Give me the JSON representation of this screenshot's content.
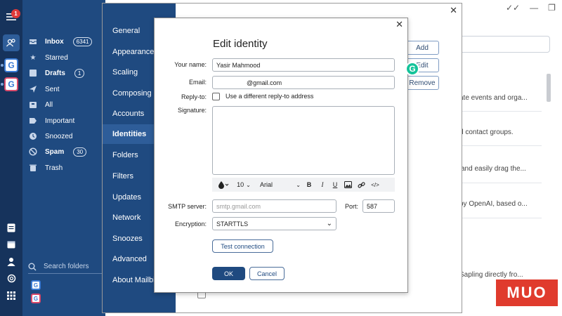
{
  "rail": {
    "notification_count": "1"
  },
  "folders": [
    {
      "label": "Inbox",
      "count": "6341",
      "bold": true
    },
    {
      "label": "Starred",
      "count": "",
      "bold": false
    },
    {
      "label": "Drafts",
      "count": "1",
      "bold": true
    },
    {
      "label": "Sent",
      "count": "",
      "bold": false
    },
    {
      "label": "All",
      "count": "",
      "bold": false
    },
    {
      "label": "Important",
      "count": "",
      "bold": false
    },
    {
      "label": "Snoozed",
      "count": "",
      "bold": false
    },
    {
      "label": "Spam",
      "count": "30",
      "bold": true
    },
    {
      "label": "Trash",
      "count": "",
      "bold": false
    }
  ],
  "search_folders": "Search folders",
  "background_rows": [
    "ate events and orga...",
    "d contact groups.",
    "and easily drag the...",
    "by OpenAI, based o...",
    "Sapling directly fro..."
  ],
  "settings": {
    "nav": [
      "General",
      "Appearance",
      "Scaling",
      "Composing",
      "Accounts",
      "Identities",
      "Folders",
      "Filters",
      "Updates",
      "Network",
      "Snoozes",
      "Advanced",
      "About Mailbird"
    ],
    "active_index": 5,
    "buttons": {
      "add": "Add",
      "edit": "Edit",
      "remove": "Remove"
    }
  },
  "modal": {
    "title": "Edit identity",
    "labels": {
      "name": "Your name:",
      "email": "Email:",
      "reply_to": "Reply-to:",
      "signature": "Signature:",
      "smtp": "SMTP server:",
      "port": "Port:",
      "encryption": "Encryption:"
    },
    "name_value": "Yasir Mahmood",
    "email_value": "@gmail.com",
    "reply_checkbox_label": "Use a different reply-to address",
    "toolbar": {
      "font_size": "10",
      "font_family": "Arial",
      "bold": "B",
      "italic": "I",
      "underline": "U",
      "code": "</>"
    },
    "smtp_placeholder": "smtp.gmail.com",
    "port_value": "587",
    "encryption_value": "STARTTLS",
    "test_button": "Test connection",
    "ok_button": "OK",
    "cancel_button": "Cancel"
  },
  "grammarly_letter": "G",
  "watermark": "MUO",
  "colors": {
    "rail": "#16335c",
    "sidebar": "#1f4a80",
    "active_nav": "#2e5d99",
    "primary_button": "#1f4a80",
    "grammarly": "#15c39a",
    "watermark": "#e03b2d"
  }
}
